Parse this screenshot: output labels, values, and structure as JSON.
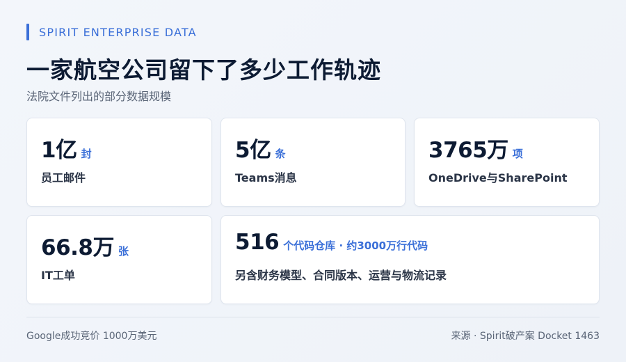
{
  "header": {
    "eyebrow": "SPIRIT ENTERPRISE DATA",
    "title": "一家航空公司留下了多少工作轨迹",
    "subtitle": "法院文件列出的部分数据规模"
  },
  "stats": [
    {
      "value": "1亿",
      "unit": "封",
      "label": "员工邮件"
    },
    {
      "value": "5亿",
      "unit": "条",
      "label": "Teams消息"
    },
    {
      "value": "3765万",
      "unit": "项",
      "label": "OneDrive与SharePoint"
    },
    {
      "value": "66.8万",
      "unit": "张",
      "label": "IT工单"
    },
    {
      "value": "516",
      "unit": "个代码仓库 · 约3000万行代码",
      "label": "另含财务模型、合同版本、运营与物流记录"
    }
  ],
  "footer": {
    "left": "Google成功竞价 1000万美元",
    "right": "来源 · Spirit破产案 Docket 1463"
  },
  "colors": {
    "accent": "#3a6fd8",
    "title": "#0d1b33",
    "muted": "#5a6577"
  }
}
